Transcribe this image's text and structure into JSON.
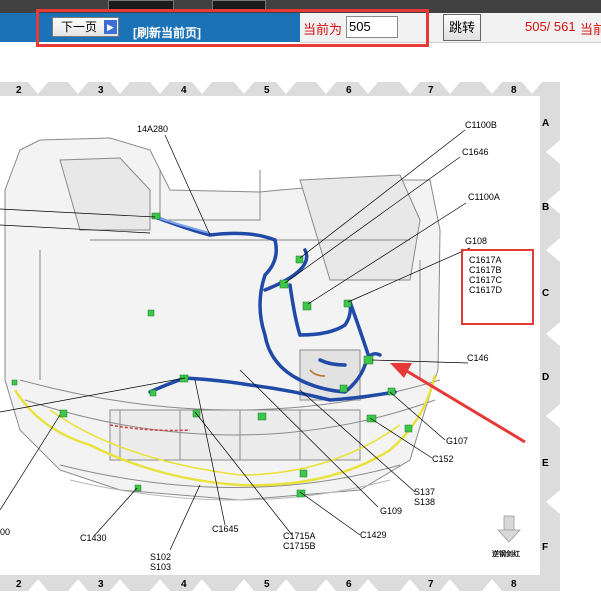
{
  "toolbar": {
    "next_label": "下一页",
    "refresh_label": "[刷新当前页]",
    "current_label": "当前为",
    "current_value": "505",
    "jump_label": "跳转",
    "page_count": "505/ 561",
    "current_label_repeat": "当前"
  },
  "grid": {
    "columns": [
      "2",
      "3",
      "4",
      "5",
      "6",
      "7",
      "8"
    ],
    "rows": [
      "A",
      "B",
      "C",
      "D",
      "E",
      "F"
    ]
  },
  "connectors": {
    "c_14a280": "14A280",
    "c_c1100b": "C1100B",
    "c_c1646": "C1646",
    "c_c1100a": "C1100A",
    "c_g108": "G108",
    "c_c146": "C146",
    "c_g107": "G107",
    "c_c152": "C152",
    "c_s137": "S137",
    "c_s138": "S138",
    "c_g109": "G109",
    "c_c1429": "C1429",
    "c_c1715a": "C1715A",
    "c_c1715b": "C1715B",
    "c_c1645": "C1645",
    "c_s102": "S102",
    "c_s103": "S103",
    "c_c1430": "C1430",
    "c_00": "00"
  },
  "highlight_box": {
    "lines": "C1617A\nC1617B\nC1617C\nC1617D"
  },
  "download_label": "逆钢剑红"
}
